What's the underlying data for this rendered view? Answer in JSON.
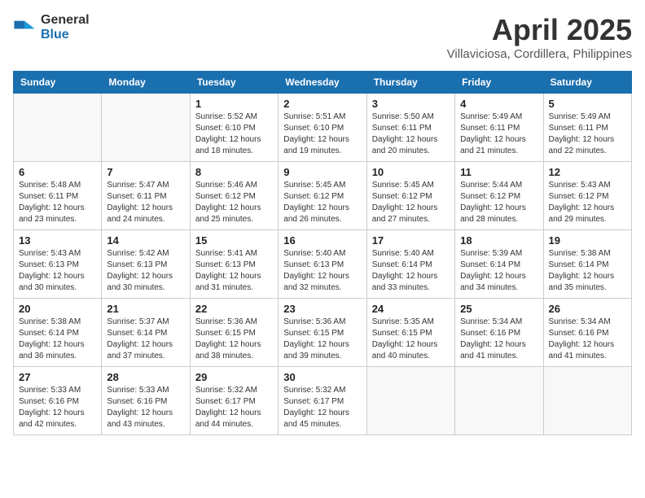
{
  "logo": {
    "general": "General",
    "blue": "Blue"
  },
  "title": "April 2025",
  "subtitle": "Villaviciosa, Cordillera, Philippines",
  "weekdays": [
    "Sunday",
    "Monday",
    "Tuesday",
    "Wednesday",
    "Thursday",
    "Friday",
    "Saturday"
  ],
  "weeks": [
    [
      {
        "day": "",
        "info": ""
      },
      {
        "day": "",
        "info": ""
      },
      {
        "day": "1",
        "info": "Sunrise: 5:52 AM\nSunset: 6:10 PM\nDaylight: 12 hours and 18 minutes."
      },
      {
        "day": "2",
        "info": "Sunrise: 5:51 AM\nSunset: 6:10 PM\nDaylight: 12 hours and 19 minutes."
      },
      {
        "day": "3",
        "info": "Sunrise: 5:50 AM\nSunset: 6:11 PM\nDaylight: 12 hours and 20 minutes."
      },
      {
        "day": "4",
        "info": "Sunrise: 5:49 AM\nSunset: 6:11 PM\nDaylight: 12 hours and 21 minutes."
      },
      {
        "day": "5",
        "info": "Sunrise: 5:49 AM\nSunset: 6:11 PM\nDaylight: 12 hours and 22 minutes."
      }
    ],
    [
      {
        "day": "6",
        "info": "Sunrise: 5:48 AM\nSunset: 6:11 PM\nDaylight: 12 hours and 23 minutes."
      },
      {
        "day": "7",
        "info": "Sunrise: 5:47 AM\nSunset: 6:11 PM\nDaylight: 12 hours and 24 minutes."
      },
      {
        "day": "8",
        "info": "Sunrise: 5:46 AM\nSunset: 6:12 PM\nDaylight: 12 hours and 25 minutes."
      },
      {
        "day": "9",
        "info": "Sunrise: 5:45 AM\nSunset: 6:12 PM\nDaylight: 12 hours and 26 minutes."
      },
      {
        "day": "10",
        "info": "Sunrise: 5:45 AM\nSunset: 6:12 PM\nDaylight: 12 hours and 27 minutes."
      },
      {
        "day": "11",
        "info": "Sunrise: 5:44 AM\nSunset: 6:12 PM\nDaylight: 12 hours and 28 minutes."
      },
      {
        "day": "12",
        "info": "Sunrise: 5:43 AM\nSunset: 6:12 PM\nDaylight: 12 hours and 29 minutes."
      }
    ],
    [
      {
        "day": "13",
        "info": "Sunrise: 5:43 AM\nSunset: 6:13 PM\nDaylight: 12 hours and 30 minutes."
      },
      {
        "day": "14",
        "info": "Sunrise: 5:42 AM\nSunset: 6:13 PM\nDaylight: 12 hours and 30 minutes."
      },
      {
        "day": "15",
        "info": "Sunrise: 5:41 AM\nSunset: 6:13 PM\nDaylight: 12 hours and 31 minutes."
      },
      {
        "day": "16",
        "info": "Sunrise: 5:40 AM\nSunset: 6:13 PM\nDaylight: 12 hours and 32 minutes."
      },
      {
        "day": "17",
        "info": "Sunrise: 5:40 AM\nSunset: 6:14 PM\nDaylight: 12 hours and 33 minutes."
      },
      {
        "day": "18",
        "info": "Sunrise: 5:39 AM\nSunset: 6:14 PM\nDaylight: 12 hours and 34 minutes."
      },
      {
        "day": "19",
        "info": "Sunrise: 5:38 AM\nSunset: 6:14 PM\nDaylight: 12 hours and 35 minutes."
      }
    ],
    [
      {
        "day": "20",
        "info": "Sunrise: 5:38 AM\nSunset: 6:14 PM\nDaylight: 12 hours and 36 minutes."
      },
      {
        "day": "21",
        "info": "Sunrise: 5:37 AM\nSunset: 6:14 PM\nDaylight: 12 hours and 37 minutes."
      },
      {
        "day": "22",
        "info": "Sunrise: 5:36 AM\nSunset: 6:15 PM\nDaylight: 12 hours and 38 minutes."
      },
      {
        "day": "23",
        "info": "Sunrise: 5:36 AM\nSunset: 6:15 PM\nDaylight: 12 hours and 39 minutes."
      },
      {
        "day": "24",
        "info": "Sunrise: 5:35 AM\nSunset: 6:15 PM\nDaylight: 12 hours and 40 minutes."
      },
      {
        "day": "25",
        "info": "Sunrise: 5:34 AM\nSunset: 6:16 PM\nDaylight: 12 hours and 41 minutes."
      },
      {
        "day": "26",
        "info": "Sunrise: 5:34 AM\nSunset: 6:16 PM\nDaylight: 12 hours and 41 minutes."
      }
    ],
    [
      {
        "day": "27",
        "info": "Sunrise: 5:33 AM\nSunset: 6:16 PM\nDaylight: 12 hours and 42 minutes."
      },
      {
        "day": "28",
        "info": "Sunrise: 5:33 AM\nSunset: 6:16 PM\nDaylight: 12 hours and 43 minutes."
      },
      {
        "day": "29",
        "info": "Sunrise: 5:32 AM\nSunset: 6:17 PM\nDaylight: 12 hours and 44 minutes."
      },
      {
        "day": "30",
        "info": "Sunrise: 5:32 AM\nSunset: 6:17 PM\nDaylight: 12 hours and 45 minutes."
      },
      {
        "day": "",
        "info": ""
      },
      {
        "day": "",
        "info": ""
      },
      {
        "day": "",
        "info": ""
      }
    ]
  ]
}
